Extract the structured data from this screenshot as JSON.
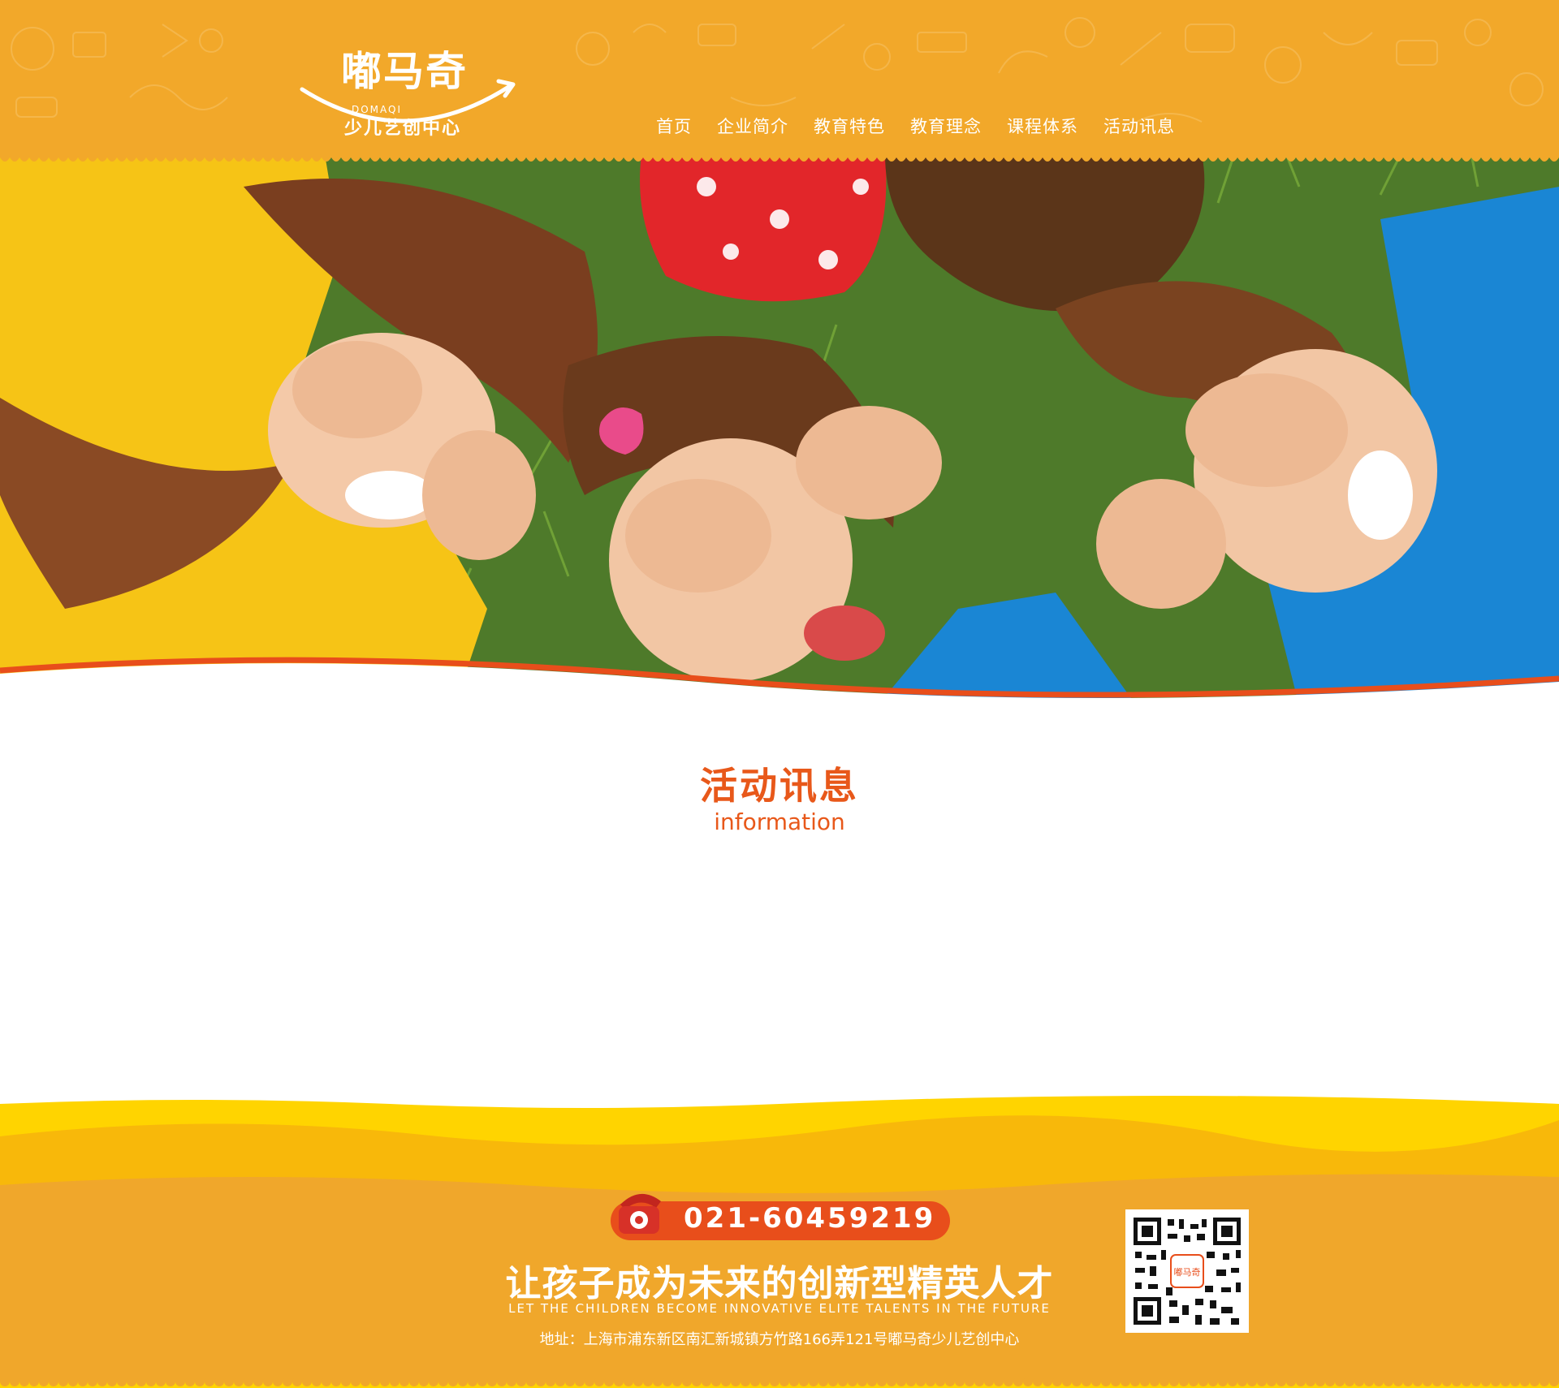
{
  "brand": {
    "name": "嘟马奇",
    "latin": "DOMAQI",
    "tagline": "少儿艺创中心"
  },
  "nav": {
    "items": [
      {
        "label": "首页"
      },
      {
        "label": "企业简介"
      },
      {
        "label": "教育特色"
      },
      {
        "label": "教育理念"
      },
      {
        "label": "课程体系"
      },
      {
        "label": "活动讯息"
      }
    ]
  },
  "section": {
    "title": "活动讯息",
    "subtitle": "information"
  },
  "footer": {
    "phone": "021-60459219",
    "slogan": "让孩子成为未来的创新型精英人才",
    "slogan_en": "LET THE CHILDREN BECOME INNOVATIVE ELITE TALENTS IN THE FUTURE",
    "address": "地址：上海市浦东新区南汇新城镇方竹路166弄121号嘟马奇少儿艺创中心",
    "qr_label": "嘟马奇"
  },
  "colors": {
    "header_orange": "#F2A82A",
    "accent_red": "#E8581A",
    "footer_orange": "#F0A72B",
    "footer_yellow": "#FFD400"
  },
  "icons": {
    "phone": "telephone-icon",
    "qr": "qr-code-icon"
  }
}
